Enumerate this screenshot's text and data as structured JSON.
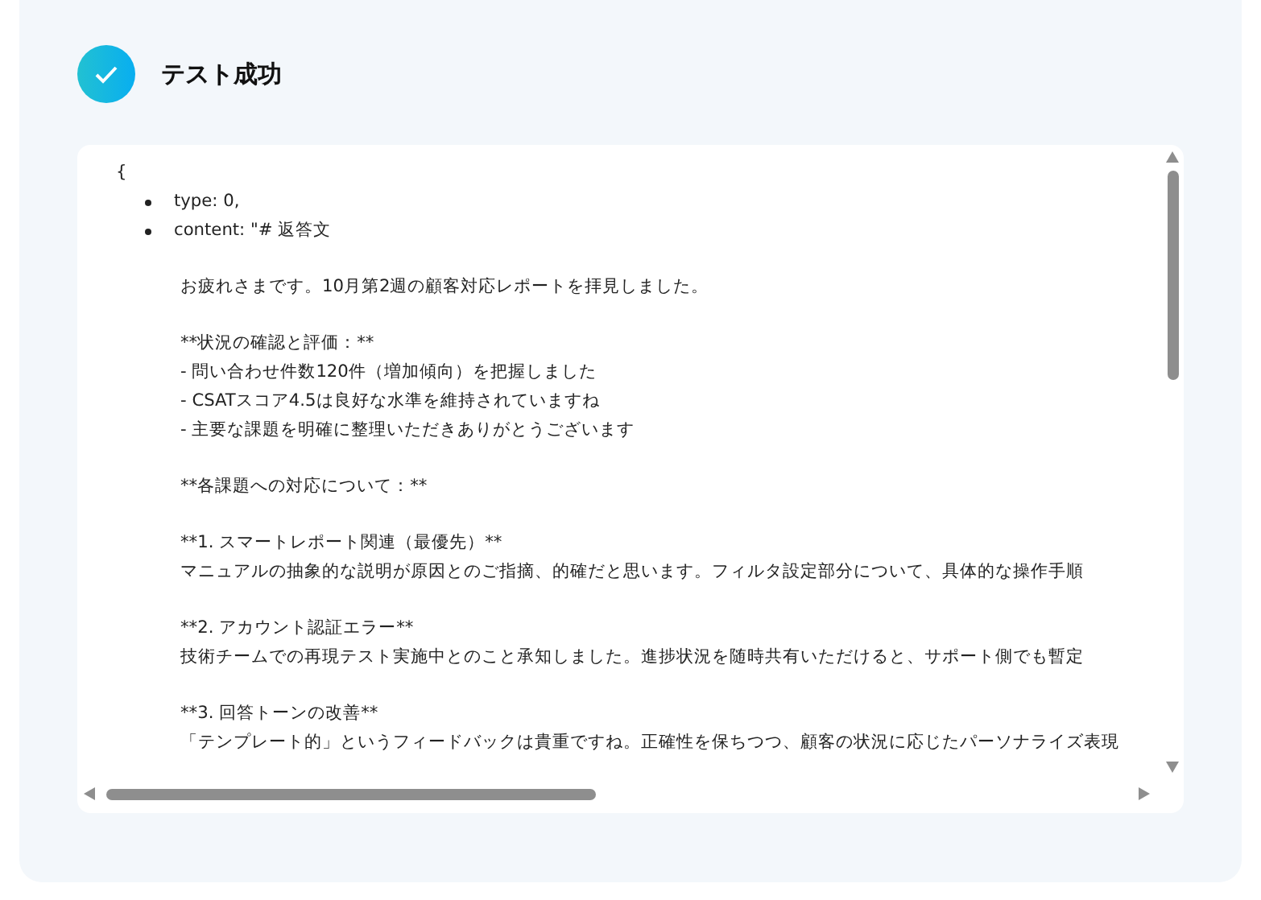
{
  "header": {
    "title": "テスト成功"
  },
  "output": {
    "open_brace": "{",
    "items": [
      {
        "text": "type: 0,"
      },
      {
        "text": "content: \"# 返答文",
        "paragraphs": [
          [
            "お疲れさまです。10月第2週の顧客対応レポートを拝見しました。"
          ],
          [
            "**状況の確認と評価：**",
            "- 問い合わせ件数120件（増加傾向）を把握しました",
            "- CSATスコア4.5は良好な水準を維持されていますね",
            "- 主要な課題を明確に整理いただきありがとうございます"
          ],
          [
            "**各課題への対応について：**"
          ],
          [
            "**1. スマートレポート関連（最優先）**",
            "マニュアルの抽象的な説明が原因とのご指摘、的確だと思います。フィルタ設定部分について、具体的な操作手順"
          ],
          [
            "**2. アカウント認証エラー**",
            "技術チームでの再現テスト実施中とのこと承知しました。進捗状況を随時共有いただけると、サポート側でも暫定"
          ],
          [
            "**3. 回答トーンの改善**",
            "「テンプレート的」というフィードバックは貴重ですね。正確性を保ちつつ、顧客の状況に応じたパーソナライズ表現"
          ]
        ]
      }
    ]
  }
}
